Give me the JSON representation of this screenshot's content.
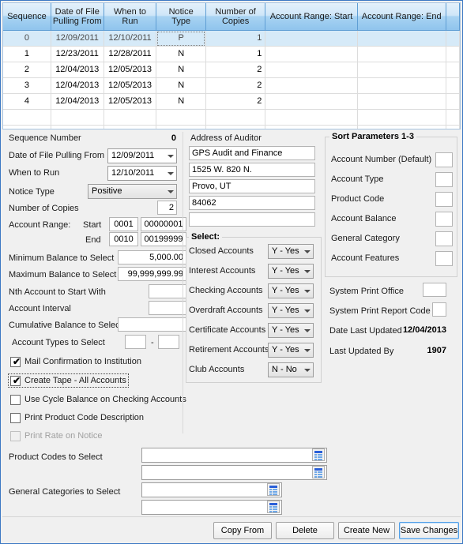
{
  "grid": {
    "columns": [
      "Sequence",
      "Date of File Pulling From",
      "When to Run",
      "Notice Type",
      "Number of Copies",
      "Account Range: Start",
      "Account Range: End"
    ],
    "rows": [
      {
        "sequence": "0",
        "date_pulling": "12/09/2011",
        "when_to_run": "12/10/2011",
        "notice_type": "P",
        "copies": "1",
        "range_start": "",
        "range_end": ""
      },
      {
        "sequence": "1",
        "date_pulling": "12/23/2011",
        "when_to_run": "12/28/2011",
        "notice_type": "N",
        "copies": "1",
        "range_start": "",
        "range_end": ""
      },
      {
        "sequence": "2",
        "date_pulling": "12/04/2013",
        "when_to_run": "12/05/2013",
        "notice_type": "N",
        "copies": "2",
        "range_start": "",
        "range_end": ""
      },
      {
        "sequence": "3",
        "date_pulling": "12/04/2013",
        "when_to_run": "12/05/2013",
        "notice_type": "N",
        "copies": "2",
        "range_start": "",
        "range_end": ""
      },
      {
        "sequence": "4",
        "date_pulling": "12/04/2013",
        "when_to_run": "12/05/2013",
        "notice_type": "N",
        "copies": "2",
        "range_start": "",
        "range_end": ""
      }
    ]
  },
  "form": {
    "sequence_number_label": "Sequence Number",
    "sequence_number_value": "0",
    "date_pulling_label": "Date of File Pulling From",
    "date_pulling_value": "12/09/2011",
    "when_to_run_label": "When to Run",
    "when_to_run_value": "12/10/2011",
    "notice_type_label": "Notice Type",
    "notice_type_value": "Positive",
    "number_copies_label": "Number of Copies",
    "number_copies_value": "2",
    "account_range_label": "Account Range:",
    "start_label": "Start",
    "end_label": "End",
    "start_office": "0001",
    "start_account": "00000001",
    "end_office": "0010",
    "end_account": "00199999",
    "min_balance_label": "Minimum Balance to Select",
    "min_balance_value": "5,000.00",
    "max_balance_label": "Maximum Balance to Select",
    "max_balance_value": "99,999,999.99",
    "nth_account_label": "Nth Account to Start With",
    "nth_account_value": "",
    "account_interval_label": "Account Interval",
    "account_interval_value": "",
    "cumulative_balance_label": "Cumulative Balance to Select",
    "cumulative_balance_value": "",
    "account_types_label": "Account Types to Select",
    "account_types_from": "",
    "account_types_to": "",
    "account_types_dash": "-"
  },
  "checkboxes": [
    {
      "label": "Mail Confirmation to Institution",
      "checked": true,
      "disabled": false,
      "focused": false
    },
    {
      "label": "Create Tape - All Accounts",
      "checked": true,
      "disabled": false,
      "focused": true
    },
    {
      "label": "Use Cycle Balance on Checking Accounts",
      "checked": false,
      "disabled": false,
      "focused": false
    },
    {
      "label": "Print Product Code Description",
      "checked": false,
      "disabled": false,
      "focused": false
    },
    {
      "label": "Print Rate on Notice",
      "checked": false,
      "disabled": true,
      "focused": false
    }
  ],
  "lookups": {
    "product_codes_label": "Product Codes to Select",
    "product_code_1": "",
    "product_code_2": "",
    "general_categories_label": "General Categories to Select",
    "general_category_1": "",
    "general_category_2": "",
    "icon": "table-lookup-icon"
  },
  "auditor": {
    "title": "Address of Auditor",
    "line1": "GPS Audit and Finance",
    "line2": "1525 W. 820 N.",
    "line3": "Provo, UT",
    "line4": "84062",
    "line5": ""
  },
  "select_group": {
    "title": "Select",
    "title_colon": ":",
    "items": [
      {
        "label": "Closed Accounts",
        "value": "Y - Yes"
      },
      {
        "label": "Interest Accounts",
        "value": "Y - Yes"
      },
      {
        "label": "Checking Accounts",
        "value": "Y - Yes"
      },
      {
        "label": "Overdraft Accounts",
        "value": "Y - Yes"
      },
      {
        "label": "Certificate Accounts",
        "value": "Y - Yes"
      },
      {
        "label": "Retirement Accounts",
        "value": "Y - Yes"
      },
      {
        "label": "Club Accounts",
        "value": "N - No"
      }
    ]
  },
  "sort_parameters": {
    "title": "Sort Parameters 1-3",
    "items": [
      {
        "label": "Account Number (Default)",
        "value": ""
      },
      {
        "label": "Account Type",
        "value": ""
      },
      {
        "label": "Product Code",
        "value": ""
      },
      {
        "label": "Account Balance",
        "value": ""
      },
      {
        "label": "General Category",
        "value": ""
      },
      {
        "label": "Account Features",
        "value": ""
      }
    ]
  },
  "system": {
    "print_office_label": "System Print Office",
    "print_office_value": "",
    "print_report_code_label": "System Print Report Code",
    "print_report_code_value": "",
    "date_last_updated_label": "Date Last Updated",
    "date_last_updated_value": "12/04/2013",
    "last_updated_by_label": "Last Updated By",
    "last_updated_by_value": "1907"
  },
  "buttons": {
    "copy_from": "Copy From",
    "delete": "Delete",
    "create_new": "Create New",
    "save_changes": "Save Changes"
  },
  "colors": {
    "window_border": "#3b78c3",
    "header_blue": "#8fc4ed",
    "selection": "#d6eaf8",
    "background": "#f0f0f0",
    "lookup_icon": "#2a5fd8"
  }
}
